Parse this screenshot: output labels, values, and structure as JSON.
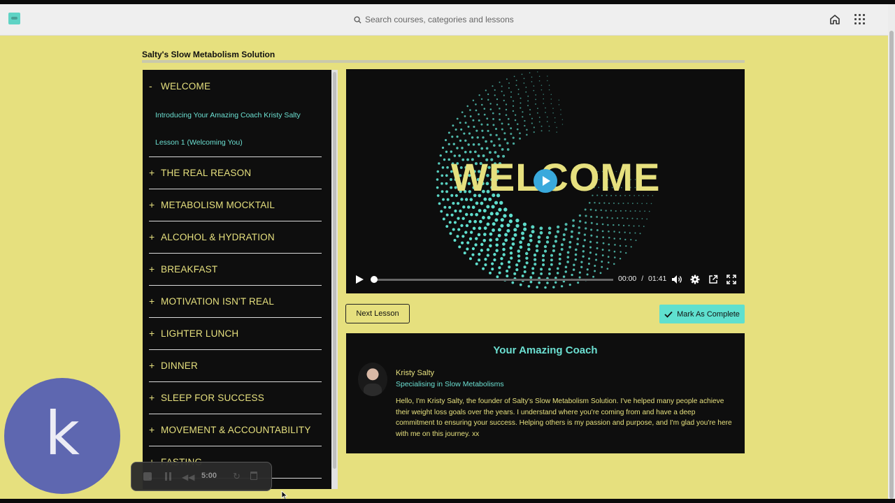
{
  "search": {
    "placeholder": "Search courses, categories and lessons"
  },
  "course": {
    "title": "Salty's Slow Metabolism Solution"
  },
  "sidebar": {
    "expanded": {
      "sign": "-",
      "title": "WELCOME",
      "lessons": [
        "Introducing Your Amazing Coach Kristy Salty",
        "Lesson 1 (Welcoming You)"
      ]
    },
    "sections": [
      {
        "sign": "+",
        "title": "THE REAL REASON"
      },
      {
        "sign": "+",
        "title": "METABOLISM MOCKTAIL"
      },
      {
        "sign": "+",
        "title": "ALCOHOL & HYDRATION"
      },
      {
        "sign": "+",
        "title": "BREAKFAST"
      },
      {
        "sign": "+",
        "title": "MOTIVATION ISN'T REAL"
      },
      {
        "sign": "+",
        "title": "LIGHTER LUNCH"
      },
      {
        "sign": "+",
        "title": "DINNER"
      },
      {
        "sign": "+",
        "title": "SLEEP FOR SUCCESS"
      },
      {
        "sign": "+",
        "title": "MOVEMENT & ACCOUNTABILITY"
      },
      {
        "sign": "+",
        "title": "FASTING"
      }
    ]
  },
  "video": {
    "overlay_text": "WELCOME",
    "current_time": "00:00",
    "separator": "/",
    "duration": "01:41",
    "progress": 0
  },
  "actions": {
    "next_label": "Next Lesson",
    "complete_label": "Mark As Complete"
  },
  "coach": {
    "heading": "Your Amazing Coach",
    "name": "Kristy Salty",
    "specialty": "Specialising in Slow Metabolisms",
    "bio": "Hello, I'm Kristy Salty, the founder of Salty's Slow Metabolism Solution. I've helped many people achieve their weight loss goals over the years. I understand where you're coming from and have a deep commitment to ensuring your success. Helping others is my passion and purpose, and I'm glad you're here with me on this journey. xx"
  },
  "webcam": {
    "letter": "k"
  },
  "recorder": {
    "time": "5:00"
  },
  "colors": {
    "accent_yellow": "#e6e07e",
    "accent_teal": "#5fe0cf",
    "panel": "#0e0e0e",
    "play_blue": "#39a9dc"
  }
}
